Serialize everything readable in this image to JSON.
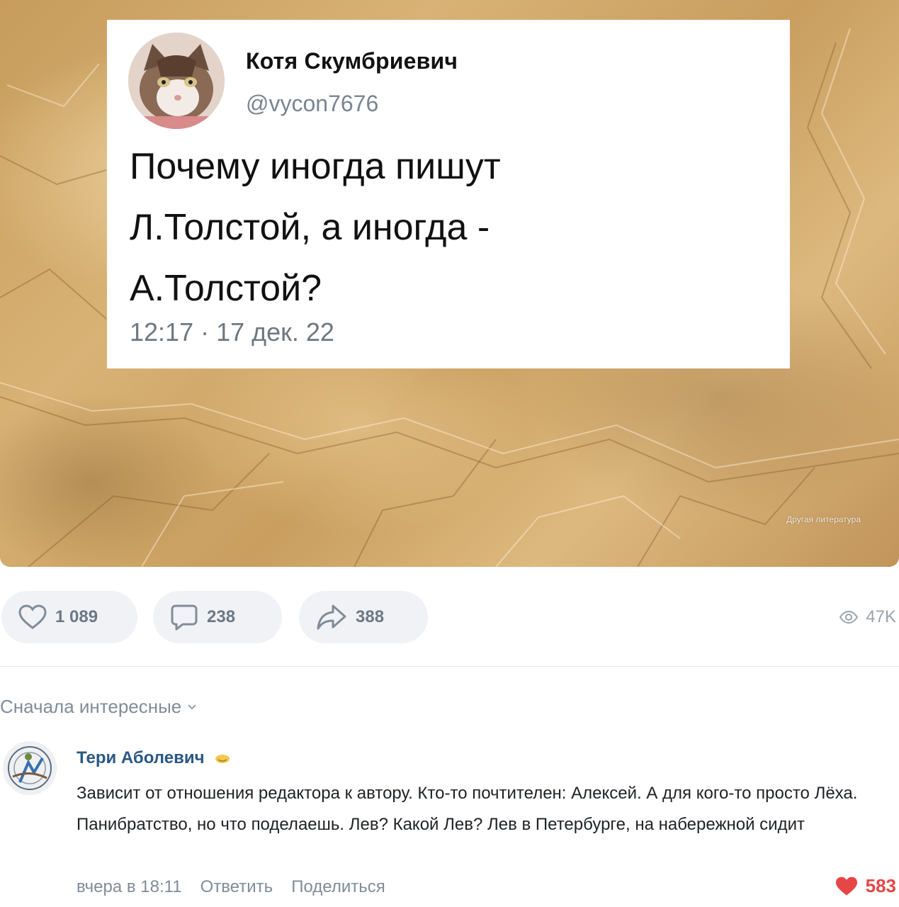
{
  "tweet": {
    "author_name": "Котя Скумбриевич",
    "handle": "@vycon7676",
    "text_lines": [
      "Почему иногда пишут",
      "Л.Толстой, а иногда -",
      "А.Толстой?"
    ],
    "timestamp": "12:17 · 17 дек. 22"
  },
  "post": {
    "watermark": "Другая литература",
    "likes": "1 089",
    "comments": "238",
    "reposts": "388",
    "views": "47K"
  },
  "comments_section": {
    "sort_label": "Сначала интересные",
    "comment": {
      "author": "Тери Аболевич",
      "text": "Зависит от отношения редактора к автору. Кто-то почтителен: Алексей. А для кого-то просто Лёха. Панибратство, но что поделаешь. Лев? Какой Лев? Лев в Петербурге, на набережной сидит",
      "time": "вчера в 18:11",
      "reply_label": "Ответить",
      "share_label": "Поделиться",
      "likes": "583"
    }
  },
  "colors": {
    "paper": "#d2a96b",
    "link_blue": "#2a5885",
    "like_red": "#e64646",
    "muted_gray": "#818c99"
  },
  "icons": [
    "heart-icon",
    "comment-icon",
    "share-icon",
    "eye-icon",
    "chevron-down-icon",
    "emoji-badge-icon",
    "heart-filled-icon"
  ]
}
